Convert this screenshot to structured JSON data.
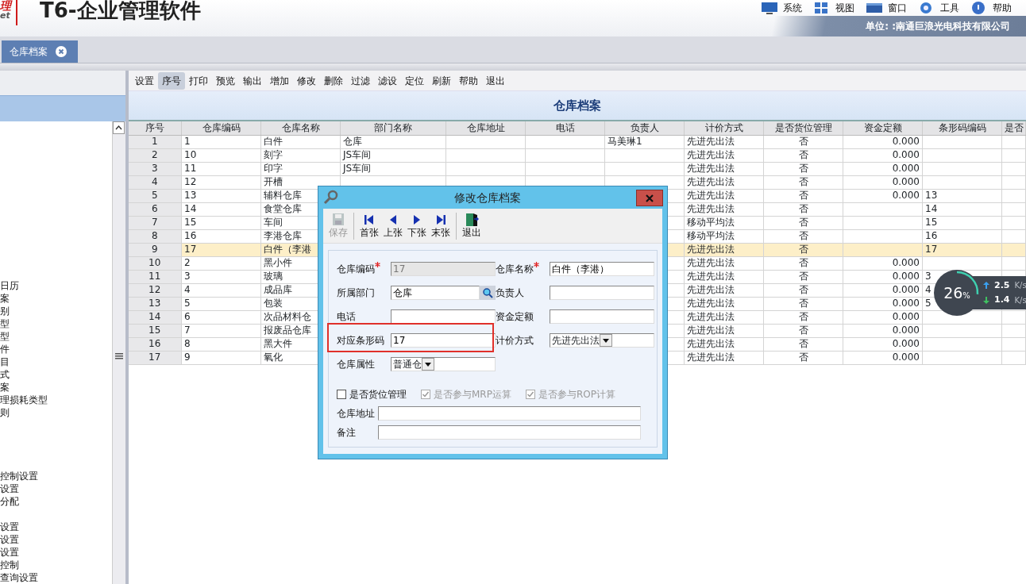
{
  "header": {
    "logo_fragment": "理",
    "logo_fragment_2": "et",
    "title": "T6-企业管理软件",
    "menu": [
      {
        "label": "系统"
      },
      {
        "label": "视图"
      },
      {
        "label": "窗口"
      },
      {
        "label": "工具"
      },
      {
        "label": "帮助"
      }
    ],
    "unit": "单位: :南通巨浪光电科技有限公司"
  },
  "tabs": [
    {
      "label": "仓库档案",
      "selected": true
    }
  ],
  "sidebar": {
    "groups": [
      [
        "日历",
        "案",
        "别",
        "型",
        "型",
        "件",
        "目",
        "式",
        "案",
        "理损耗类型",
        "则"
      ],
      [
        "控制设置",
        "设置",
        "分配"
      ],
      [
        "设置",
        "设置",
        "设置",
        "控制",
        "查询设置"
      ]
    ]
  },
  "toolbar": [
    {
      "label": "设置",
      "selected": false
    },
    {
      "label": "序号",
      "selected": true
    },
    {
      "label": "打印",
      "selected": false
    },
    {
      "label": "预览",
      "selected": false
    },
    {
      "label": "输出",
      "selected": false
    },
    {
      "label": "增加",
      "selected": false
    },
    {
      "label": "修改",
      "selected": false
    },
    {
      "label": "删除",
      "selected": false
    },
    {
      "label": "过滤",
      "selected": false
    },
    {
      "label": "滤设",
      "selected": false
    },
    {
      "label": "定位",
      "selected": false
    },
    {
      "label": "刷新",
      "selected": false
    },
    {
      "label": "帮助",
      "selected": false
    },
    {
      "label": "退出",
      "selected": false
    }
  ],
  "grid": {
    "title": "仓库档案",
    "columns": [
      "序号",
      "仓库编码",
      "仓库名称",
      "部门名称",
      "仓库地址",
      "电话",
      "负责人",
      "计价方式",
      "是否货位管理",
      "资金定额",
      "条形码编码",
      "是否"
    ],
    "rows": [
      {
        "selected": false,
        "cells": [
          "1",
          "1",
          "白件",
          "仓库",
          null,
          null,
          "马美琳1",
          "先进先出法",
          "否",
          "0.000",
          null,
          null
        ]
      },
      {
        "selected": false,
        "cells": [
          "2",
          "10",
          "刻字",
          "JS车间",
          null,
          null,
          null,
          "先进先出法",
          "否",
          "0.000",
          null,
          null
        ]
      },
      {
        "selected": false,
        "cells": [
          "3",
          "11",
          "印字",
          "JS车间",
          null,
          null,
          null,
          "先进先出法",
          "否",
          "0.000",
          null,
          null
        ]
      },
      {
        "selected": false,
        "cells": [
          "4",
          "12",
          "开槽",
          null,
          null,
          null,
          null,
          "先进先出法",
          "否",
          "0.000",
          null,
          null
        ]
      },
      {
        "selected": false,
        "cells": [
          "5",
          "13",
          "辅料仓库",
          null,
          null,
          null,
          null,
          "先进先出法",
          "否",
          "0.000",
          "13",
          null
        ]
      },
      {
        "selected": false,
        "cells": [
          "6",
          "14",
          "食堂仓库",
          null,
          null,
          null,
          null,
          "先进先出法",
          "否",
          null,
          "14",
          null
        ]
      },
      {
        "selected": false,
        "cells": [
          "7",
          "15",
          "车间",
          null,
          null,
          null,
          null,
          "移动平均法",
          "否",
          null,
          "15",
          null
        ]
      },
      {
        "selected": false,
        "cells": [
          "8",
          "16",
          "李港仓库",
          null,
          null,
          null,
          null,
          "移动平均法",
          "否",
          null,
          "16",
          null
        ]
      },
      {
        "selected": true,
        "cells": [
          "9",
          "17",
          "白件（李港",
          null,
          null,
          null,
          null,
          "先进先出法",
          "否",
          null,
          "17",
          null
        ]
      },
      {
        "selected": false,
        "cells": [
          "10",
          "2",
          "黑小件",
          null,
          null,
          null,
          null,
          "先进先出法",
          "否",
          "0.000",
          null,
          null
        ]
      },
      {
        "selected": false,
        "cells": [
          "11",
          "3",
          "玻璃",
          null,
          null,
          null,
          null,
          "先进先出法",
          "否",
          "0.000",
          "3",
          null
        ]
      },
      {
        "selected": false,
        "cells": [
          "12",
          "4",
          "成品库",
          null,
          null,
          null,
          null,
          "先进先出法",
          "否",
          "0.000",
          "4",
          null
        ]
      },
      {
        "selected": false,
        "cells": [
          "13",
          "5",
          "包装",
          null,
          null,
          null,
          null,
          "先进先出法",
          "否",
          "0.000",
          "5",
          null
        ]
      },
      {
        "selected": false,
        "cells": [
          "14",
          "6",
          "次品材料仓",
          null,
          null,
          null,
          null,
          "先进先出法",
          "否",
          "0.000",
          null,
          null
        ]
      },
      {
        "selected": false,
        "cells": [
          "15",
          "7",
          "报废品仓库",
          null,
          null,
          null,
          null,
          "先进先出法",
          "否",
          "0.000",
          null,
          null
        ]
      },
      {
        "selected": false,
        "cells": [
          "16",
          "8",
          "黑大件",
          null,
          null,
          null,
          null,
          "先进先出法",
          "否",
          "0.000",
          null,
          null
        ]
      },
      {
        "selected": false,
        "cells": [
          "17",
          "9",
          "氧化",
          null,
          null,
          null,
          null,
          "先进先出法",
          "否",
          "0.000",
          null,
          null
        ]
      }
    ]
  },
  "dialog": {
    "title": "修改仓库档案",
    "tools": [
      {
        "label": "保存",
        "disabled": true
      },
      {
        "label": "首张",
        "disabled": false
      },
      {
        "label": "上张",
        "disabled": false
      },
      {
        "label": "下张",
        "disabled": false
      },
      {
        "label": "末张",
        "disabled": false
      },
      {
        "label": "退出",
        "disabled": false
      }
    ],
    "fields": [
      {
        "label": "仓库编码",
        "required": true,
        "kind": "text",
        "value": "17",
        "disabled": true
      },
      {
        "label": "仓库名称",
        "required": true,
        "kind": "text",
        "value": "白件（李港）",
        "disabled": false
      },
      {
        "label": "所属部门",
        "required": false,
        "kind": "lookup",
        "value": "仓库",
        "disabled": false
      },
      {
        "label": "负责人",
        "required": false,
        "kind": "text",
        "disabled": false
      },
      {
        "label": "电话",
        "required": false,
        "kind": "text",
        "disabled": false
      },
      {
        "label": "资金定额",
        "required": false,
        "kind": "text",
        "disabled": false
      },
      {
        "label": "对应条形码",
        "required": false,
        "kind": "text",
        "value": "17",
        "disabled": false,
        "highlighted": true
      },
      {
        "label": "计价方式",
        "required": false,
        "kind": "select",
        "value": "先进先出法",
        "disabled": false
      },
      {
        "label": "仓库属性",
        "required": false,
        "kind": "select",
        "value": "普通仓",
        "disabled": false
      }
    ],
    "checks": [
      {
        "label": "是否货位管理",
        "checked": false,
        "disabled": false
      },
      {
        "label": "是否参与MRP运算",
        "checked": true,
        "disabled": true
      },
      {
        "label": "是否参与ROP计算",
        "checked": true,
        "disabled": true
      }
    ],
    "wide_fields": [
      {
        "label": "仓库地址"
      },
      {
        "label": "备注"
      }
    ]
  },
  "network_monitor": {
    "percent": "26",
    "percent_unit": "%",
    "upload": "2.5",
    "upload_unit": "K/s",
    "download": "1.4",
    "download_unit": "K/s"
  }
}
